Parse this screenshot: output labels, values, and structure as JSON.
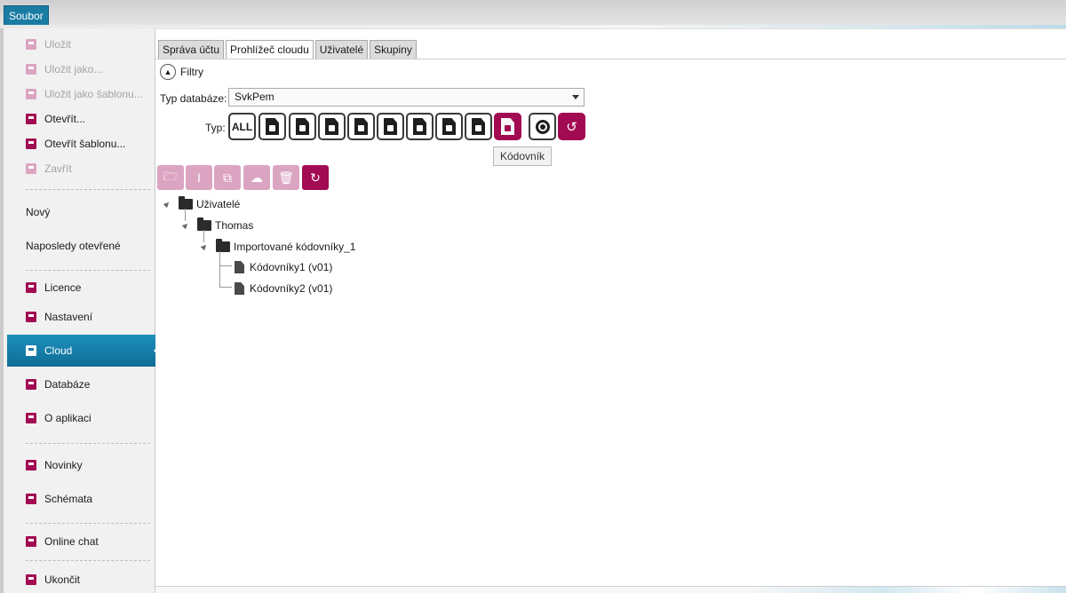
{
  "ribbon": {
    "file_tab": "Soubor"
  },
  "sidebar": {
    "items": [
      {
        "label": "Uložit",
        "icon": "save-icon",
        "disabled": true
      },
      {
        "label": "Uložit jako...",
        "icon": "save-as-icon",
        "disabled": true
      },
      {
        "label": "Uložit jako šablonu...",
        "icon": "save-template-icon",
        "disabled": true
      },
      {
        "label": "Otevřít...",
        "icon": "folder-open-icon",
        "disabled": false
      },
      {
        "label": "Otevřít šablonu...",
        "icon": "folder-open-template-icon",
        "disabled": false
      },
      {
        "label": "Zavřít",
        "icon": "close-file-icon",
        "disabled": true
      },
      {
        "label": "Nový"
      },
      {
        "label": "Naposledy otevřené"
      },
      {
        "label": "Licence",
        "icon": "license-icon"
      },
      {
        "label": "Nastavení",
        "icon": "settings-icon"
      },
      {
        "label": "Cloud",
        "icon": "cloud-icon",
        "active": true
      },
      {
        "label": "Databáze",
        "icon": "database-icon"
      },
      {
        "label": "O aplikaci",
        "icon": "info-icon"
      },
      {
        "label": "Novinky",
        "icon": "news-icon"
      },
      {
        "label": "Schémata",
        "icon": "schema-icon"
      },
      {
        "label": "Online chat",
        "icon": "chat-icon"
      },
      {
        "label": "Ukončit",
        "icon": "exit-icon"
      }
    ]
  },
  "main": {
    "tabs": [
      {
        "label": "Správa účtu"
      },
      {
        "label": "Prohlížeč cloudu",
        "selected": true
      },
      {
        "label": "Uživatelé"
      },
      {
        "label": "Skupiny"
      }
    ],
    "filters": {
      "toggle_label": "Filtry",
      "db_type_label": "Typ databáze:",
      "db_type_value": "SvkPem",
      "type_label": "Typ:",
      "all_label": "ALL",
      "tooltip": "Kódovník",
      "type_buttons": [
        "users-doc-icon",
        "display-doc-icon",
        "dollar-doc-icon",
        "video-doc-icon",
        "screen-doc-icon",
        "edit-doc-icon",
        "table-doc-icon",
        "list-doc-icon",
        "codebook-doc-icon"
      ]
    },
    "tree": {
      "root": "Uživatelé",
      "user": "Thomas",
      "folder": "Importované kódovníky_1",
      "files": [
        "Kódovníky1 (v01)",
        "Kódovníky2 (v01)"
      ]
    }
  },
  "colors": {
    "accent": "#a20a52",
    "accent_disabled": "#dba5c2",
    "active_nav": "#1a7ba3"
  }
}
